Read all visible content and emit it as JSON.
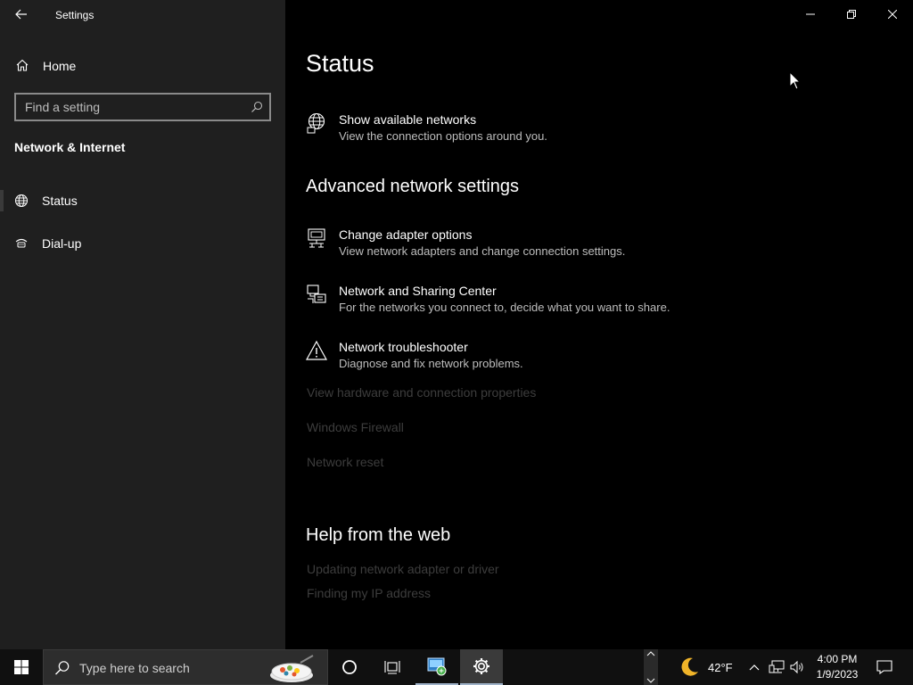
{
  "window": {
    "title": "Settings"
  },
  "sidebar": {
    "home_label": "Home",
    "search_placeholder": "Find a setting",
    "section_title": "Network & Internet",
    "items": [
      {
        "label": "Status",
        "icon": "globe-icon",
        "active": true
      },
      {
        "label": "Dial-up",
        "icon": "dialup-icon",
        "active": false
      }
    ]
  },
  "main": {
    "page_title": "Status",
    "show_networks": {
      "title": "Show available networks",
      "desc": "View the connection options around you."
    },
    "advanced_heading": "Advanced network settings",
    "advanced_items": [
      {
        "title": "Change adapter options",
        "desc": "View network adapters and change connection settings.",
        "icon": "adapter-icon"
      },
      {
        "title": "Network and Sharing Center",
        "desc": "For the networks you connect to, decide what you want to share.",
        "icon": "sharing-center-icon"
      },
      {
        "title": "Network troubleshooter",
        "desc": "Diagnose and fix network problems.",
        "icon": "warning-icon"
      }
    ],
    "links": [
      "View hardware and connection properties",
      "Windows Firewall",
      "Network reset"
    ],
    "help_heading": "Help from the web",
    "help_links": [
      "Updating network adapter or driver",
      "Finding my IP address"
    ]
  },
  "taskbar": {
    "search_text": "Type here to search",
    "weather_temp": "42°F",
    "time": "4:00 PM",
    "date": "1/9/2023"
  },
  "colors": {
    "sidebar_bg": "#1f1f1f",
    "main_bg": "#000000",
    "taskbar_bg": "#101010",
    "dim_text": "#3d3d3d",
    "secondary_text": "#bdbdbd"
  }
}
